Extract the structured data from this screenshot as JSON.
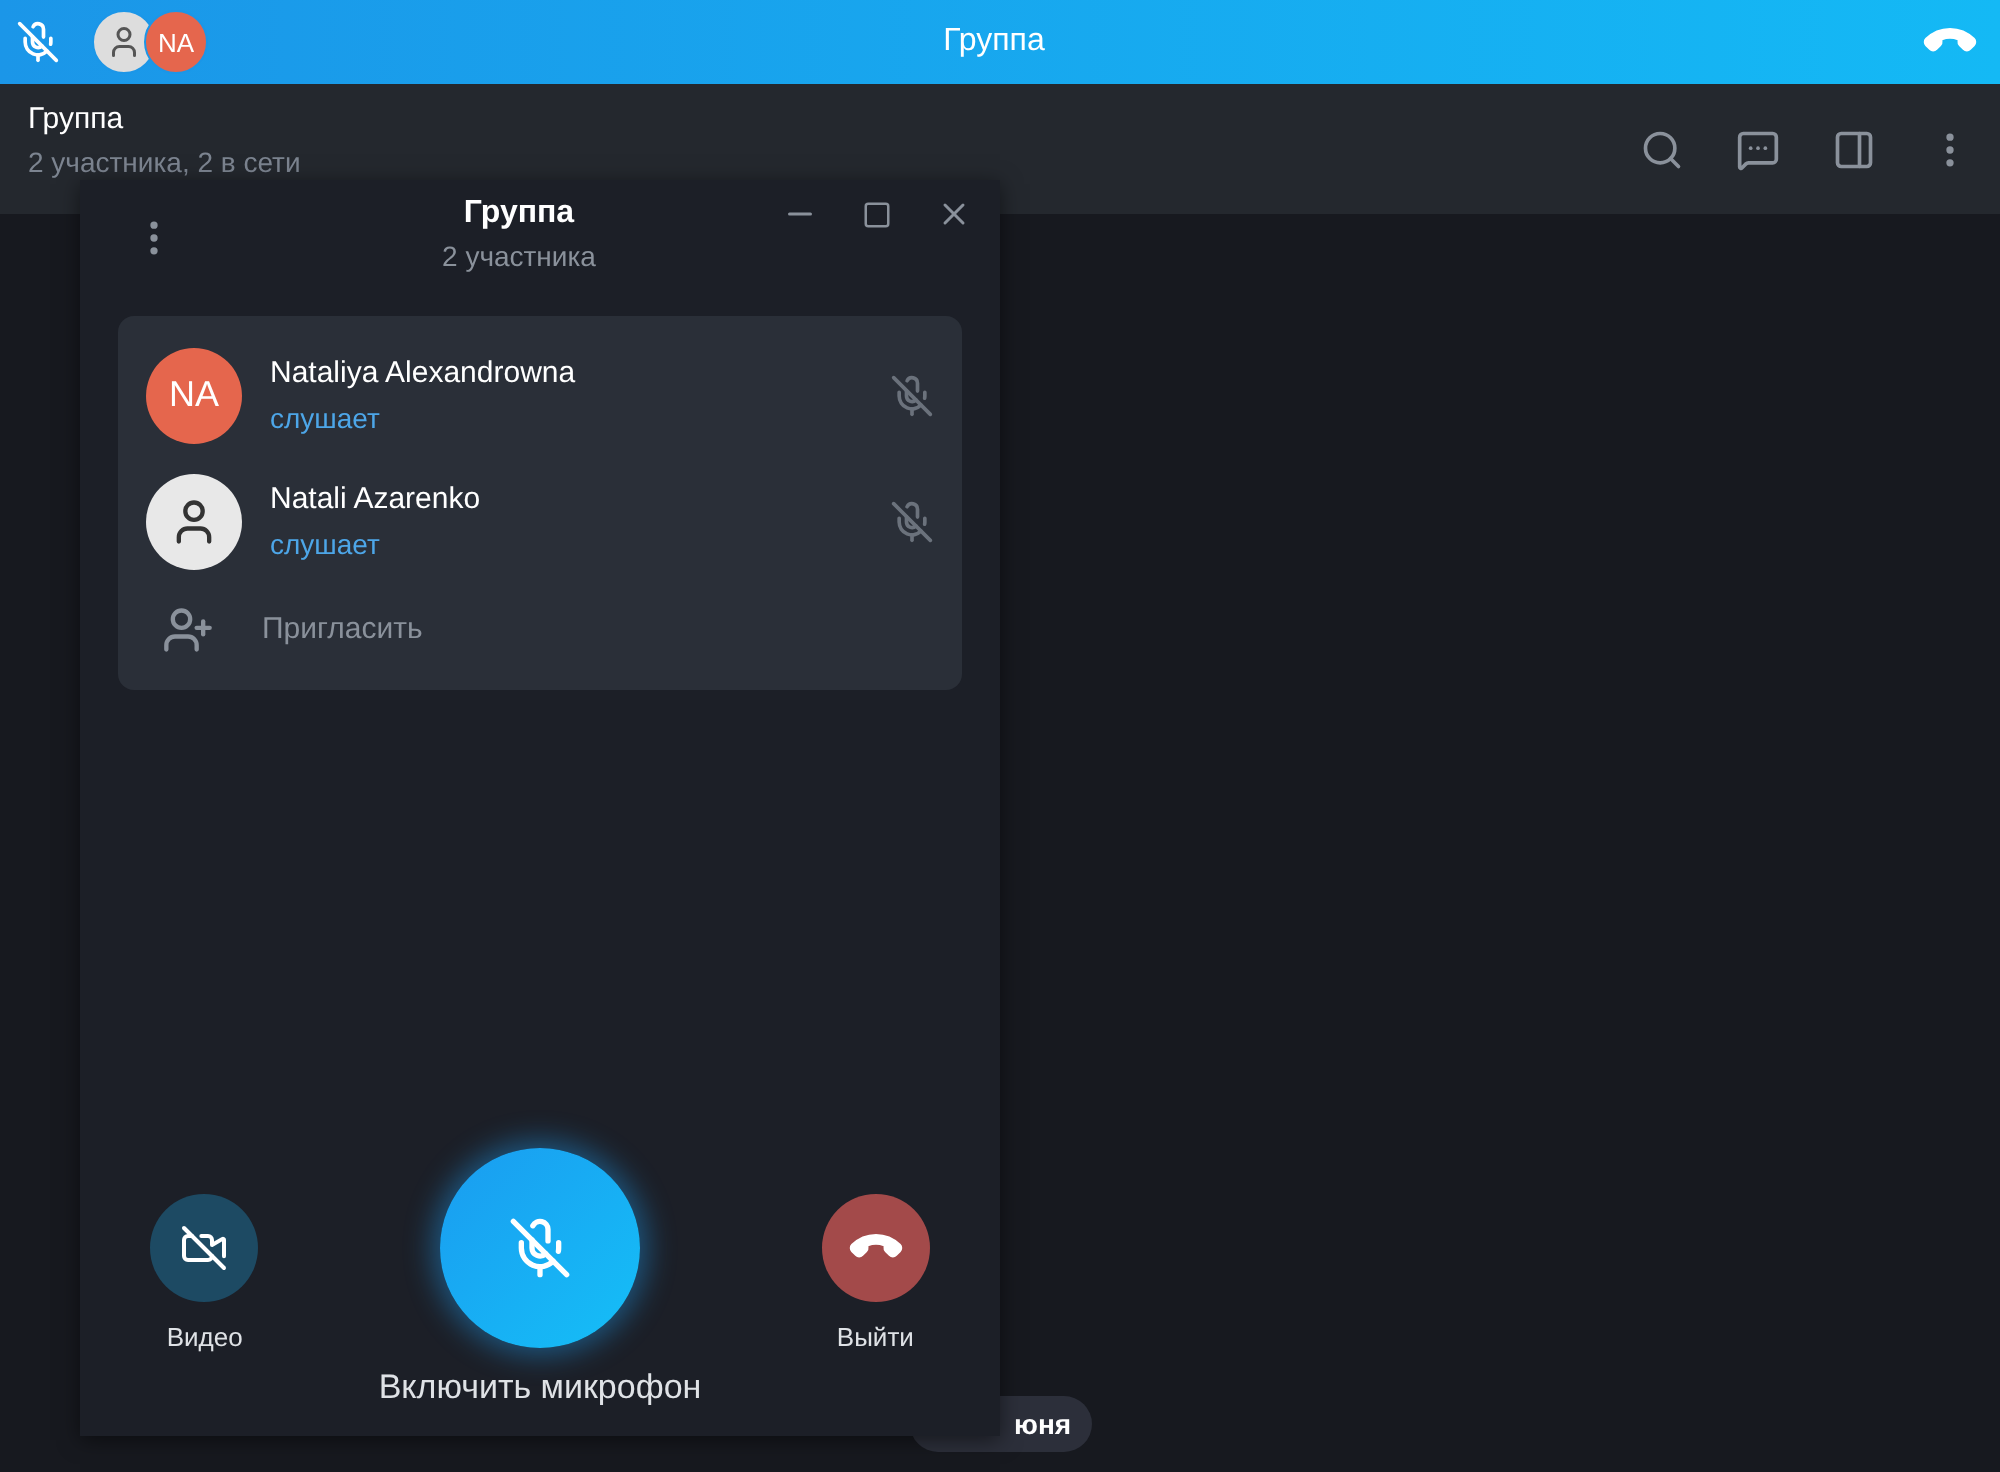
{
  "top_bar": {
    "title": "Группа",
    "avatars": [
      {
        "kind": "photo"
      },
      {
        "kind": "initials",
        "initials": "NA"
      }
    ]
  },
  "chat_header": {
    "title": "Группа",
    "subtitle": "2 участника, 2 в сети"
  },
  "date_chip": "юня",
  "call_panel": {
    "title": "Группа",
    "subtitle": "2 участника",
    "participants": [
      {
        "name": "Nataliya Alexandrowna",
        "status": "слушает",
        "avatar": {
          "kind": "initials",
          "initials": "NA"
        },
        "muted": true
      },
      {
        "name": "Natali Azarenko",
        "status": "слушает",
        "avatar": {
          "kind": "photo"
        },
        "muted": true
      }
    ],
    "invite": "Пригласить",
    "controls": [
      {
        "kind": "video",
        "label": "Видео"
      },
      {
        "kind": "mic",
        "label": "Включить микрофон"
      },
      {
        "kind": "leave",
        "label": "Выйти"
      }
    ]
  }
}
